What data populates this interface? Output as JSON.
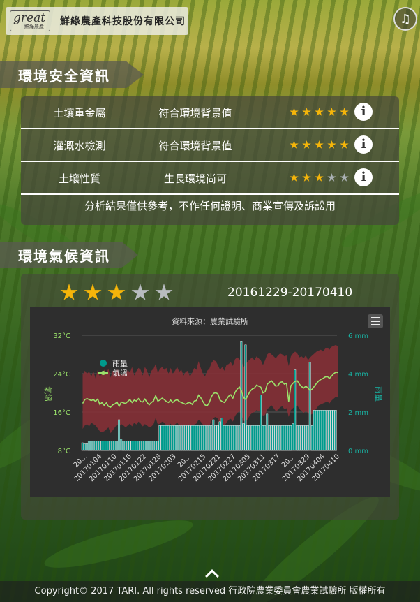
{
  "header": {
    "logo_text": "great",
    "logo_sub": "鮮綠農產",
    "company_name": "鮮綠農產科技股份有限公司",
    "music_icon": "music-note-icon"
  },
  "env_safety": {
    "title": "環境安全資訊",
    "rows": [
      {
        "name": "土壤重金屬",
        "value": "符合環境背景值",
        "rating": 5
      },
      {
        "name": "灌溉水檢測",
        "value": "符合環境背景值",
        "rating": 5
      },
      {
        "name": "土壤性質",
        "value": "生長環境尚可",
        "rating": 3
      }
    ],
    "max_rating": 5,
    "info_label": "i",
    "note": "分析結果僅供參考，不作任何證明、商業宣傳及訴訟用"
  },
  "climate": {
    "title": "環境氣候資訊",
    "rating": 3,
    "max_rating": 5,
    "date_range": "20161229-20170410"
  },
  "chart_data": {
    "type": "bar",
    "title": "資料來源：農業試驗所",
    "ylabel_left": "氣溫",
    "ylabel_right": "雨量",
    "left_axis_ticks": [
      "32°C",
      "24°C",
      "16°C",
      "8°C"
    ],
    "right_axis_ticks": [
      "6 mm",
      "4 mm",
      "2 mm",
      "0 mm"
    ],
    "ylim_temp": [
      8,
      32
    ],
    "ylim_rain": [
      0,
      6
    ],
    "legend": [
      {
        "name": "雨量",
        "color": "#009a8c"
      },
      {
        "name": "氣溫",
        "color": "#9be36b"
      }
    ],
    "x_tick_labels": [
      "20...",
      "20170104",
      "20170110",
      "20170116",
      "20170122",
      "20170128",
      "20170203",
      "20...",
      "20170215",
      "20170221",
      "20170227",
      "20170305",
      "20170311",
      "20170317",
      "20...",
      "20170329",
      "20170404",
      "20170410"
    ],
    "colors": {
      "rain": "#009a8c",
      "temp": "#9be36b",
      "range": "#8a2f36"
    },
    "rain_mm": [
      0.4,
      0.35,
      0.35,
      0.5,
      0.5,
      0.5,
      0.5,
      0.5,
      0.5,
      0.5,
      0.5,
      0.5,
      0.5,
      0.5,
      0.5,
      0.5,
      0.5,
      1.6,
      0.6,
      0.5,
      0.5,
      0.5,
      0.5,
      0.5,
      0.5,
      0.5,
      0.5,
      0.5,
      0.5,
      0.5,
      0.5,
      0.5,
      0.5,
      0.5,
      0.5,
      0.5,
      1.3,
      1.3,
      1.3,
      1.3,
      1.3,
      1.3,
      1.3,
      1.3,
      1.3,
      1.3,
      1.3,
      1.3,
      1.3,
      1.3,
      1.3,
      1.3,
      1.3,
      1.3,
      1.3,
      1.3,
      1.3,
      1.3,
      1.3,
      1.3,
      1.3,
      1.6,
      1.3,
      1.3,
      1.5,
      1.7,
      1.3,
      1.3,
      1.3,
      1.3,
      1.3,
      1.3,
      1.3,
      1.3,
      5.7,
      1.4,
      5.5,
      1.3,
      1.3,
      1.3,
      1.3,
      1.3,
      1.3,
      2.9,
      1.3,
      1.3,
      1.9,
      1.3,
      1.3,
      1.3,
      1.3,
      1.3,
      1.3,
      1.3,
      1.3,
      1.3,
      1.3,
      1.3,
      1.4,
      4.2,
      1.3,
      1.3,
      1.3,
      1.3,
      1.3,
      1.3,
      4.6,
      1.3,
      2.1,
      2.1,
      2.1,
      2.1,
      2.1,
      2.1,
      2.1,
      2.1,
      2.1,
      2.1,
      2.1
    ],
    "temp_avg": [
      17.8,
      18.6,
      18.8,
      18.6,
      18.4,
      18.6,
      18.2,
      18.7,
      17.6,
      18.0,
      17.4,
      17.9,
      17.2,
      17.0,
      17.5,
      17.7,
      18.1,
      17.2,
      18.1,
      17.9,
      17.8,
      18.2,
      18.6,
      18.0,
      18.5,
      18.3,
      18.8,
      18.2,
      18.1,
      18.7,
      18.0,
      17.5,
      18.0,
      18.3,
      19.4,
      18.3,
      18.5,
      18.9,
      18.6,
      18.2,
      18.0,
      18.5,
      18.0,
      18.4,
      18.6,
      18.2,
      18.0,
      17.8,
      17.6,
      17.9,
      18.0,
      17.6,
      18.3,
      18.4,
      19.5,
      19.0,
      18.2,
      17.5,
      17.3,
      18.0,
      19.2,
      19.9,
      20.0,
      19.8,
      18.5,
      18.2,
      18.0,
      18.6,
      19.3,
      19.6,
      18.9,
      20.1,
      20.8,
      21.2,
      20.4,
      19.0,
      18.6,
      19.5,
      20.3,
      20.8,
      21.0,
      21.6,
      21.4,
      21.2,
      20.0,
      20.2,
      21.8,
      22.2,
      22.5,
      22.0,
      21.4,
      21.5,
      22.2,
      22.3,
      21.8,
      22.0,
      18.2,
      21.5,
      22.0,
      22.4,
      22.5,
      21.8,
      21.3,
      21.0,
      21.4,
      21.0,
      20.5,
      20.8,
      21.4,
      22.0,
      22.5,
      22.8,
      23.0,
      23.3,
      23.4,
      23.0,
      23.5,
      24.0,
      24.3,
      24.2
    ],
    "temp_range": [
      [
        12.5,
        23.8
      ],
      [
        13.2,
        24.6
      ],
      [
        13.5,
        24.0
      ],
      [
        13.0,
        24.4
      ],
      [
        13.8,
        23.4
      ],
      [
        13.5,
        24.5
      ],
      [
        13.2,
        23.0
      ],
      [
        12.6,
        24.8
      ],
      [
        12.0,
        23.4
      ],
      [
        11.8,
        24.0
      ],
      [
        12.0,
        24.8
      ],
      [
        12.4,
        24.2
      ],
      [
        12.8,
        25.0
      ],
      [
        11.6,
        23.2
      ],
      [
        12.2,
        24.6
      ],
      [
        12.8,
        24.0
      ],
      [
        13.4,
        25.0
      ],
      [
        13.0,
        24.2
      ],
      [
        13.5,
        23.5
      ],
      [
        13.2,
        24.1
      ],
      [
        12.8,
        23.8
      ],
      [
        13.2,
        24.8
      ],
      [
        13.6,
        24.2
      ],
      [
        13.0,
        25.4
      ],
      [
        13.8,
        23.6
      ],
      [
        13.4,
        24.5
      ],
      [
        14.0,
        25.2
      ],
      [
        13.6,
        24.8
      ],
      [
        13.0,
        23.6
      ],
      [
        13.5,
        25.4
      ],
      [
        13.2,
        24.6
      ],
      [
        12.8,
        23.2
      ],
      [
        13.0,
        24.6
      ],
      [
        13.4,
        25.0
      ],
      [
        14.8,
        26.0
      ],
      [
        13.4,
        24.2
      ],
      [
        13.6,
        25.0
      ],
      [
        14.0,
        25.4
      ],
      [
        13.8,
        24.8
      ],
      [
        13.2,
        25.2
      ],
      [
        13.0,
        24.0
      ],
      [
        13.6,
        25.2
      ],
      [
        12.8,
        24.0
      ],
      [
        13.4,
        24.6
      ],
      [
        13.8,
        25.4
      ],
      [
        13.2,
        24.4
      ],
      [
        12.8,
        24.8
      ],
      [
        12.6,
        23.6
      ],
      [
        12.4,
        24.4
      ],
      [
        12.8,
        24.6
      ],
      [
        13.0,
        23.4
      ],
      [
        12.8,
        24.2
      ],
      [
        13.4,
        25.2
      ],
      [
        13.6,
        24.8
      ],
      [
        14.4,
        26.6
      ],
      [
        14.0,
        25.2
      ],
      [
        13.4,
        24.0
      ],
      [
        12.8,
        23.4
      ],
      [
        12.4,
        24.6
      ],
      [
        13.0,
        25.0
      ],
      [
        14.2,
        26.2
      ],
      [
        14.8,
        26.8
      ],
      [
        15.0,
        26.6
      ],
      [
        14.6,
        25.8
      ],
      [
        13.6,
        24.8
      ],
      [
        13.4,
        25.4
      ],
      [
        13.0,
        24.6
      ],
      [
        13.8,
        25.8
      ],
      [
        14.4,
        26.0
      ],
      [
        14.6,
        26.4
      ],
      [
        14.0,
        25.6
      ],
      [
        15.2,
        27.0
      ],
      [
        15.8,
        27.4
      ],
      [
        16.2,
        27.0
      ],
      [
        15.4,
        26.6
      ],
      [
        14.2,
        25.4
      ],
      [
        14.0,
        26.0
      ],
      [
        14.6,
        26.6
      ],
      [
        15.4,
        27.0
      ],
      [
        15.8,
        27.4
      ],
      [
        16.0,
        26.8
      ],
      [
        16.4,
        27.6
      ],
      [
        16.2,
        27.2
      ],
      [
        16.0,
        26.8
      ],
      [
        15.2,
        25.8
      ],
      [
        15.4,
        26.8
      ],
      [
        16.6,
        28.0
      ],
      [
        17.0,
        28.4
      ],
      [
        17.4,
        28.0
      ],
      [
        16.8,
        27.6
      ],
      [
        16.2,
        27.2
      ],
      [
        16.4,
        27.8
      ],
      [
        17.0,
        28.2
      ],
      [
        17.2,
        28.0
      ],
      [
        16.6,
        27.6
      ],
      [
        16.8,
        27.8
      ],
      [
        15.0,
        25.6
      ],
      [
        16.4,
        27.6
      ],
      [
        16.8,
        28.2
      ],
      [
        17.2,
        28.6
      ],
      [
        17.4,
        28.2
      ],
      [
        16.6,
        27.4
      ],
      [
        16.2,
        27.6
      ],
      [
        15.8,
        27.2
      ],
      [
        16.2,
        27.8
      ],
      [
        15.8,
        26.8
      ],
      [
        15.4,
        27.4
      ],
      [
        15.6,
        27.8
      ],
      [
        16.2,
        28.2
      ],
      [
        16.8,
        28.6
      ],
      [
        17.4,
        28.8
      ],
      [
        17.6,
        29.0
      ],
      [
        17.8,
        28.6
      ],
      [
        18.0,
        29.2
      ],
      [
        18.2,
        29.4
      ],
      [
        17.8,
        29.0
      ],
      [
        18.4,
        29.6
      ],
      [
        18.8,
        29.8
      ],
      [
        19.2,
        30.0
      ],
      [
        19.0,
        29.6
      ]
    ]
  },
  "footer": {
    "copyright": "Copyright© 2017 TARI. All rights reserved 行政院農業委員會農業試驗所 版權所有",
    "scroll_up_icon": "chevron-up-icon"
  }
}
